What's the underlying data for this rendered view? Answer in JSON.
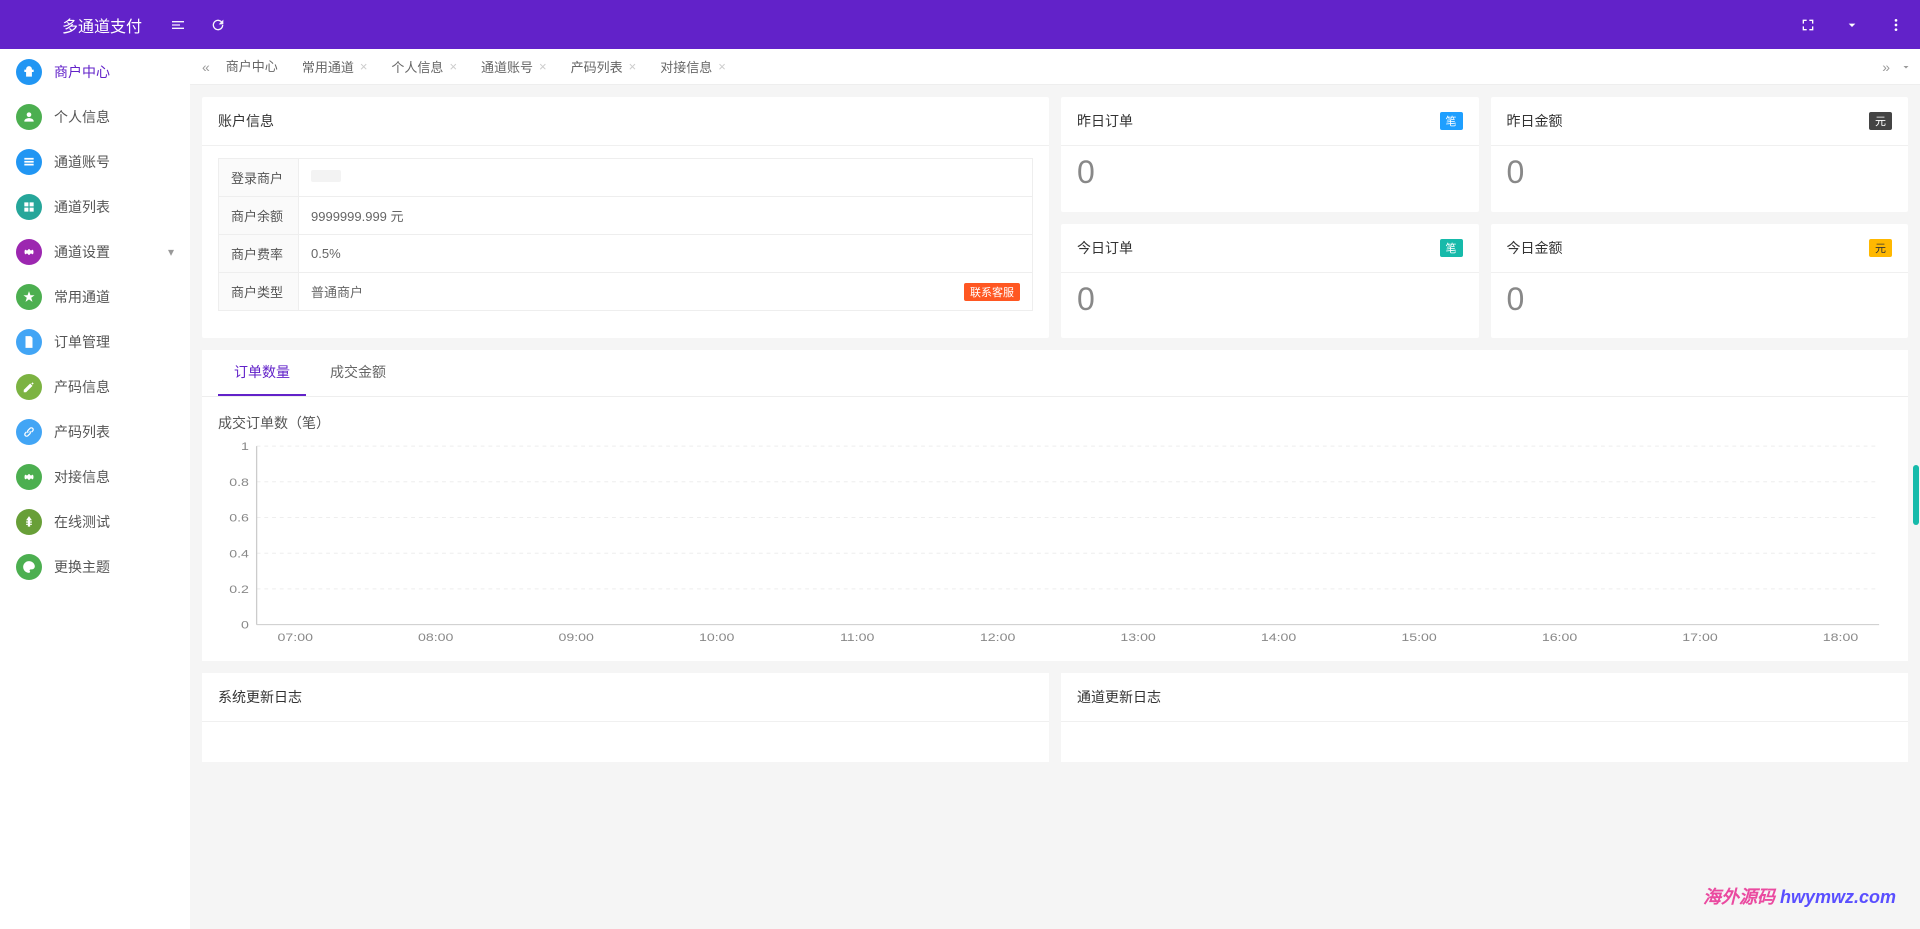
{
  "header": {
    "logo": "多通道支付"
  },
  "sidebar": [
    {
      "label": "商户中心",
      "icon": "dashboard",
      "color": "bg-blue",
      "active": true
    },
    {
      "label": "个人信息",
      "icon": "user",
      "color": "bg-green"
    },
    {
      "label": "通道账号",
      "icon": "list",
      "color": "bg-blue"
    },
    {
      "label": "通道列表",
      "icon": "grid",
      "color": "bg-teal"
    },
    {
      "label": "通道设置",
      "icon": "gear",
      "color": "bg-purple",
      "expandable": true
    },
    {
      "label": "常用通道",
      "icon": "star",
      "color": "bg-green"
    },
    {
      "label": "订单管理",
      "icon": "doc",
      "color": "bg-lightblue"
    },
    {
      "label": "产码信息",
      "icon": "edit",
      "color": "bg-lime"
    },
    {
      "label": "产码列表",
      "icon": "link",
      "color": "bg-lightblue"
    },
    {
      "label": "对接信息",
      "icon": "gear",
      "color": "bg-green"
    },
    {
      "label": "在线测试",
      "icon": "yen",
      "color": "bg-olive"
    },
    {
      "label": "更换主题",
      "icon": "palette",
      "color": "bg-green"
    }
  ],
  "tabs": [
    {
      "label": "商户中心",
      "closable": false,
      "active": true
    },
    {
      "label": "常用通道",
      "closable": true
    },
    {
      "label": "个人信息",
      "closable": true
    },
    {
      "label": "通道账号",
      "closable": true
    },
    {
      "label": "产码列表",
      "closable": true
    },
    {
      "label": "对接信息",
      "closable": true
    }
  ],
  "account": {
    "title": "账户信息",
    "rows": [
      {
        "label": "登录商户",
        "value": ""
      },
      {
        "label": "商户余额",
        "value": "9999999.999 元"
      },
      {
        "label": "商户费率",
        "value": "0.5%"
      },
      {
        "label": "商户类型",
        "value": "普通商户",
        "badge": "联系客服"
      }
    ]
  },
  "stats": [
    {
      "title": "昨日订单",
      "value": "0",
      "badge": "笔",
      "badgeClass": "badge-blue"
    },
    {
      "title": "昨日金额",
      "value": "0",
      "badge": "元",
      "badgeClass": "badge-dark"
    },
    {
      "title": "今日订单",
      "value": "0",
      "badge": "笔",
      "badgeClass": "badge-teal"
    },
    {
      "title": "今日金额",
      "value": "0",
      "badge": "元",
      "badgeClass": "badge-orange"
    }
  ],
  "chart": {
    "tabs": [
      "订单数量",
      "成交金额"
    ],
    "activeTab": 0,
    "title": "成交订单数（笔）"
  },
  "chart_data": {
    "type": "line",
    "title": "成交订单数（笔）",
    "x": [
      "07:00",
      "08:00",
      "09:00",
      "10:00",
      "11:00",
      "12:00",
      "13:00",
      "14:00",
      "15:00",
      "16:00",
      "17:00",
      "18:00"
    ],
    "values": [
      0,
      0,
      0,
      0,
      0,
      0,
      0,
      0,
      0,
      0,
      0,
      0
    ],
    "ylabel": "",
    "xlabel": "",
    "ylim": [
      0,
      1
    ],
    "yticks": [
      0,
      0.2,
      0.4,
      0.6,
      0.8,
      1
    ]
  },
  "logs": [
    {
      "title": "系统更新日志"
    },
    {
      "title": "通道更新日志"
    }
  ],
  "watermark": {
    "text": "海外源码",
    "url": "hwymwz.com"
  }
}
